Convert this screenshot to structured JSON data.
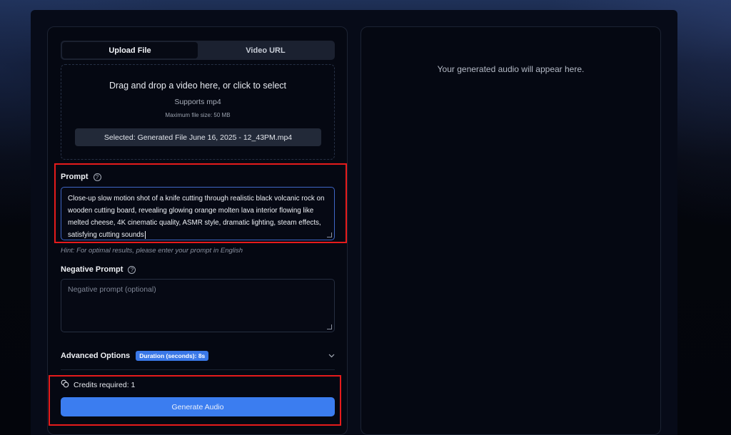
{
  "tabs": [
    {
      "label": "Upload File",
      "active": true
    },
    {
      "label": "Video URL",
      "active": false
    }
  ],
  "dropzone": {
    "title": "Drag and drop a video here, or click to select",
    "supports": "Supports mp4",
    "max_size": "Maximum file size: 50 MB",
    "selected": "Selected: Generated File June 16, 2025 - 12_43PM.mp4"
  },
  "prompt": {
    "label": "Prompt",
    "help_icon": "?",
    "value": "Close-up slow motion shot of a knife cutting through realistic black volcanic rock on wooden cutting board, revealing glowing orange molten lava interior flowing like melted cheese, 4K cinematic quality, ASMR style, dramatic lighting, steam effects, satisfying cutting sounds",
    "hint": "Hint: For optimal results, please enter your prompt in English"
  },
  "negative_prompt": {
    "label": "Negative Prompt",
    "help_icon": "?",
    "placeholder": "Negative prompt (optional)"
  },
  "advanced": {
    "label": "Advanced Options",
    "badge": "Duration (seconds): 8s"
  },
  "credits": {
    "text": "Credits required: 1"
  },
  "generate_button": {
    "label": "Generate Audio"
  },
  "output": {
    "placeholder": "Your generated audio will appear here."
  },
  "colors": {
    "accent": "#3b7df0",
    "highlight": "#e61b1b",
    "background": "#070b18"
  }
}
